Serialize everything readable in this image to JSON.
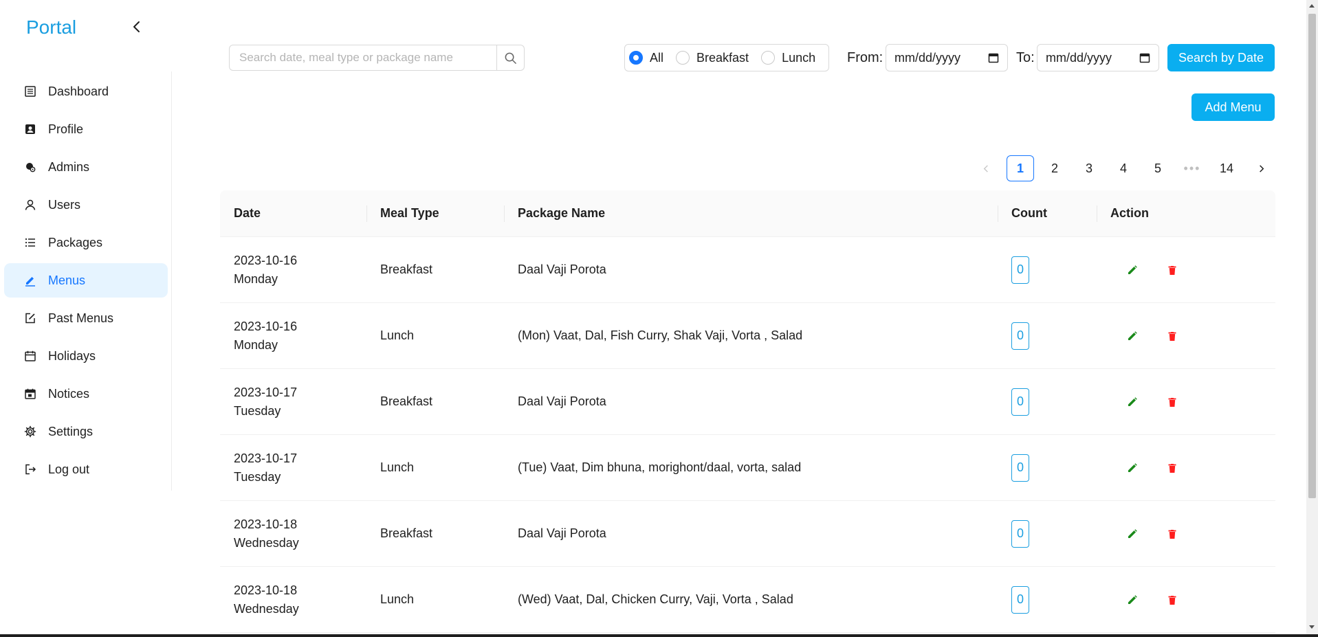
{
  "app": {
    "brand": "Portal"
  },
  "sidebar": {
    "items": [
      {
        "label": "Dashboard",
        "icon": "dashboard-icon",
        "active": false
      },
      {
        "label": "Profile",
        "icon": "profile-icon",
        "active": false
      },
      {
        "label": "Admins",
        "icon": "admins-icon",
        "active": false
      },
      {
        "label": "Users",
        "icon": "user-icon",
        "active": false
      },
      {
        "label": "Packages",
        "icon": "list-icon",
        "active": false
      },
      {
        "label": "Menus",
        "icon": "edit-icon",
        "active": true
      },
      {
        "label": "Past Menus",
        "icon": "form-icon",
        "active": false
      },
      {
        "label": "Holidays",
        "icon": "calendar-icon",
        "active": false
      },
      {
        "label": "Notices",
        "icon": "schedule-icon",
        "active": false
      },
      {
        "label": "Settings",
        "icon": "gear-icon",
        "active": false
      },
      {
        "label": "Log out",
        "icon": "logout-icon",
        "active": false
      }
    ]
  },
  "toolbar": {
    "search_placeholder": "Search date, meal type or package name",
    "meal_filter": {
      "options": [
        "All",
        "Breakfast",
        "Lunch"
      ],
      "selected": "All"
    },
    "from_label": "From:",
    "from_value": "mm/dd/yyyy",
    "to_label": "To:",
    "to_value": "mm/dd/yyyy",
    "search_by_date_label": "Search by Date",
    "add_menu_label": "Add Menu"
  },
  "pagination": {
    "pages": [
      "1",
      "2",
      "3",
      "4",
      "5"
    ],
    "ellipsis": "•••",
    "last": "14",
    "current": "1"
  },
  "table": {
    "headers": {
      "date": "Date",
      "meal_type": "Meal Type",
      "package_name": "Package Name",
      "count": "Count",
      "action": "Action"
    },
    "rows": [
      {
        "date": "2023-10-16",
        "day": "Monday",
        "meal_type": "Breakfast",
        "package_name": "Daal Vaji Porota",
        "count": "0"
      },
      {
        "date": "2023-10-16",
        "day": "Monday",
        "meal_type": "Lunch",
        "package_name": "(Mon) Vaat, Dal, Fish Curry, Shak Vaji, Vorta , Salad",
        "count": "0"
      },
      {
        "date": "2023-10-17",
        "day": "Tuesday",
        "meal_type": "Breakfast",
        "package_name": "Daal Vaji Porota",
        "count": "0"
      },
      {
        "date": "2023-10-17",
        "day": "Tuesday",
        "meal_type": "Lunch",
        "package_name": "(Tue) Vaat, Dim bhuna, morighont/daal, vorta, salad",
        "count": "0"
      },
      {
        "date": "2023-10-18",
        "day": "Wednesday",
        "meal_type": "Breakfast",
        "package_name": "Daal Vaji Porota",
        "count": "0"
      },
      {
        "date": "2023-10-18",
        "day": "Wednesday",
        "meal_type": "Lunch",
        "package_name": "(Wed) Vaat, Dal, Chicken Curry, Vaji, Vorta , Salad",
        "count": "0"
      }
    ]
  },
  "colors": {
    "accent": "#1677ff",
    "brand": "#1a9ee0",
    "primary_button": "#0aaef0",
    "edit": "#1a8a1a",
    "delete": "#ff1f1f",
    "active_nav_bg": "#e6f4ff"
  }
}
